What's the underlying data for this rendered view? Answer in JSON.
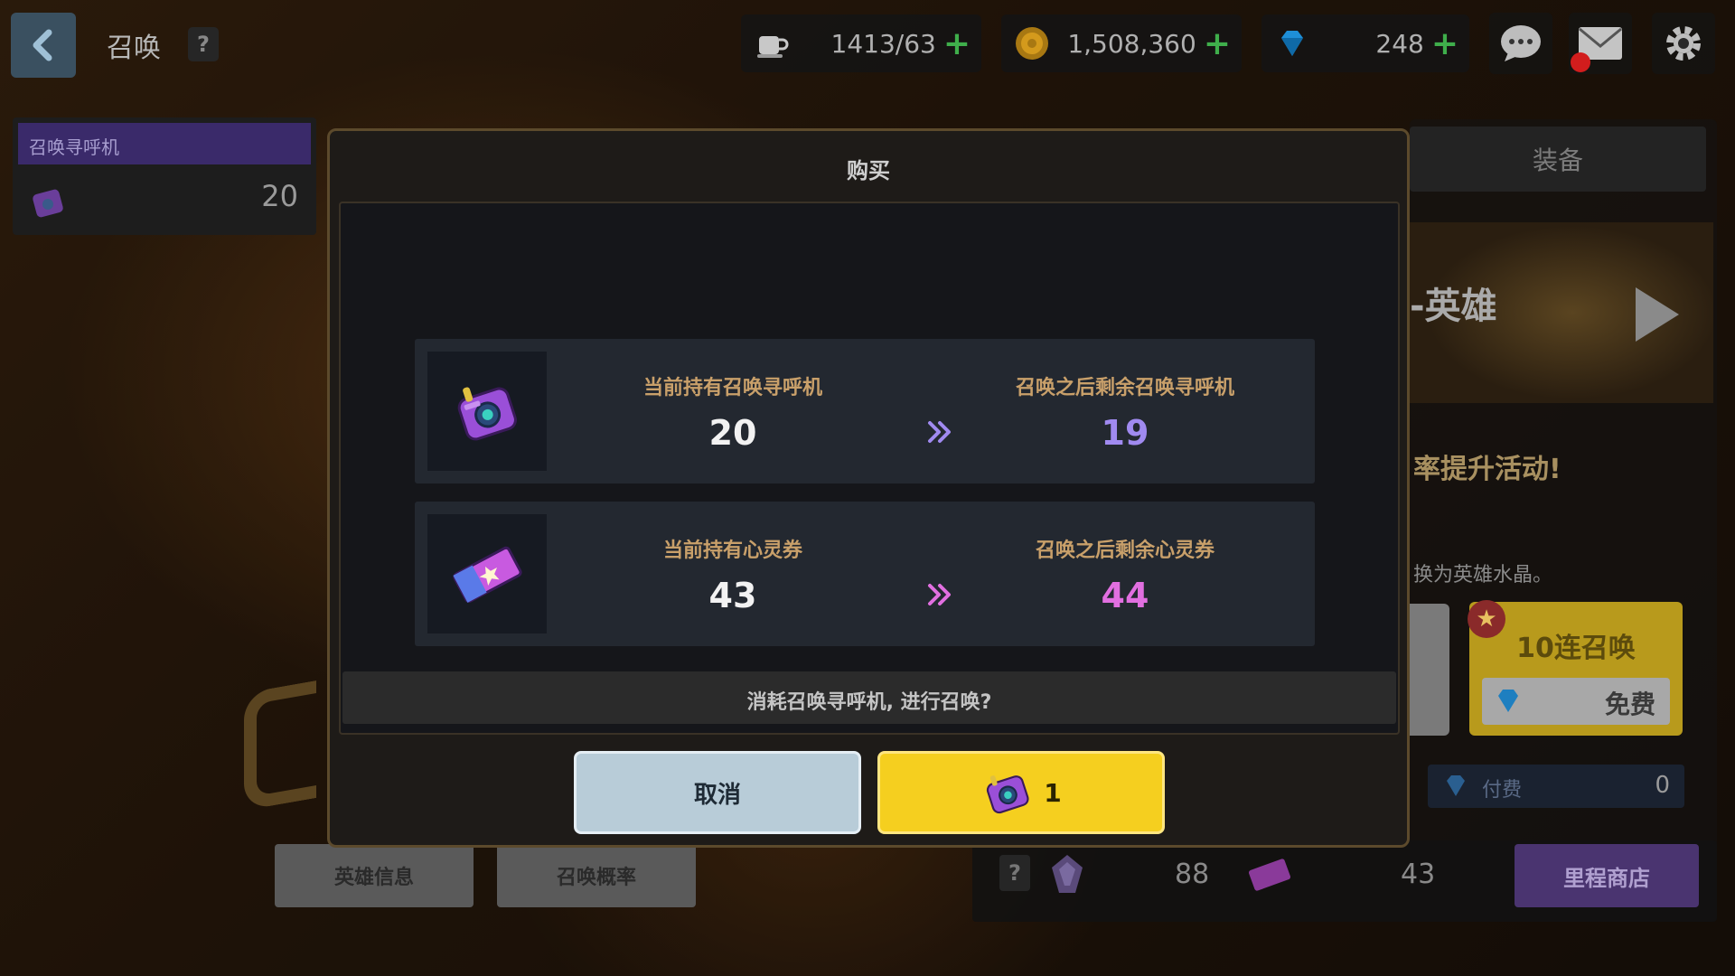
{
  "topbar": {
    "title": "召唤",
    "help": "?",
    "energy": "1413/63",
    "gold": "1,508,360",
    "gems": "248",
    "plus": "+"
  },
  "left_panel": {
    "header": "召唤寻呼机",
    "count": "20"
  },
  "right_panel": {
    "tab_equip": "装备",
    "banner_title": "-英雄",
    "event_text": "率提升活动!",
    "crystal_text": "换为英雄水晶。",
    "ten_summon_label": "10连召唤",
    "ten_summon_price": "免费",
    "paid_label": "付费",
    "paid_count": "0",
    "strip_help": "?",
    "gem_count": "88",
    "ticket_count": "43",
    "milestone_shop": "里程商店"
  },
  "bottom_left": {
    "hero_info": "英雄信息",
    "summon_rate": "召唤概率"
  },
  "modal": {
    "title": "购买",
    "pager_row": {
      "current_label": "当前持有召唤寻呼机",
      "current_value": "20",
      "after_label": "召唤之后剩余召唤寻呼机",
      "after_value": "19"
    },
    "ticket_row": {
      "current_label": "当前持有心灵券",
      "current_value": "43",
      "after_label": "召唤之后剩余心灵券",
      "after_value": "44"
    },
    "confirm_text": "消耗召唤寻呼机, 进行召唤?",
    "cancel_label": "取消",
    "confirm_cost": "1"
  },
  "colors": {
    "confirm_button": "#f5cf1f",
    "cancel_button": "#b8ccd8",
    "pager_after_value": "#a08af0",
    "ticket_after_value": "#e16fe0",
    "label_text": "#c9a06a"
  },
  "icons": {
    "back": "chevron-left-icon",
    "energy": "coffee-cup-icon",
    "gold": "gold-coin-icon",
    "gem": "diamond-icon",
    "chat": "chat-bubble-icon",
    "mail": "mail-icon",
    "settings": "gear-icon",
    "pager": "summon-pager-icon",
    "ticket": "spirit-ticket-icon",
    "arrow": "double-chevron-right-icon"
  }
}
